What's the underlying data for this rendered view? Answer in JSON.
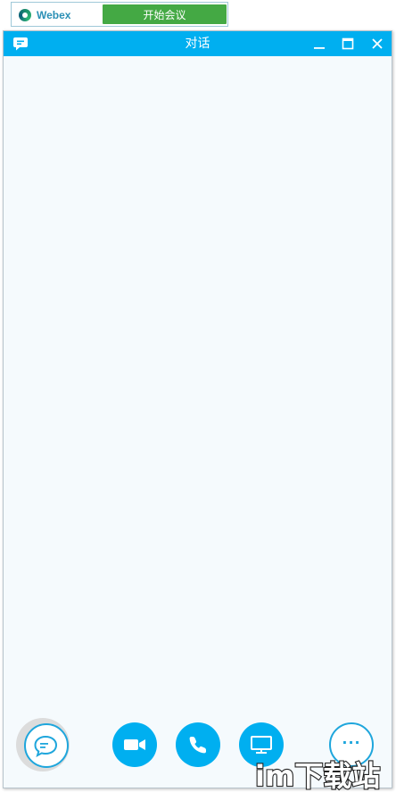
{
  "webex_bar": {
    "brand": "Webex",
    "start_meeting_label": "开始会议"
  },
  "window": {
    "title": "对话"
  },
  "toolbar": {
    "more_label": "···"
  },
  "watermark": {
    "text": "im下载站"
  },
  "colors": {
    "titlebar": "#00aff0",
    "start_button": "#44a944",
    "content_bg": "#f5fafd",
    "accent": "#1fa6dc"
  },
  "icons": [
    "webex-logo-icon",
    "chat-bubble-icon",
    "minimize-icon",
    "maximize-icon",
    "close-icon",
    "video-camera-icon",
    "phone-icon",
    "monitor-icon",
    "more-icon"
  ]
}
